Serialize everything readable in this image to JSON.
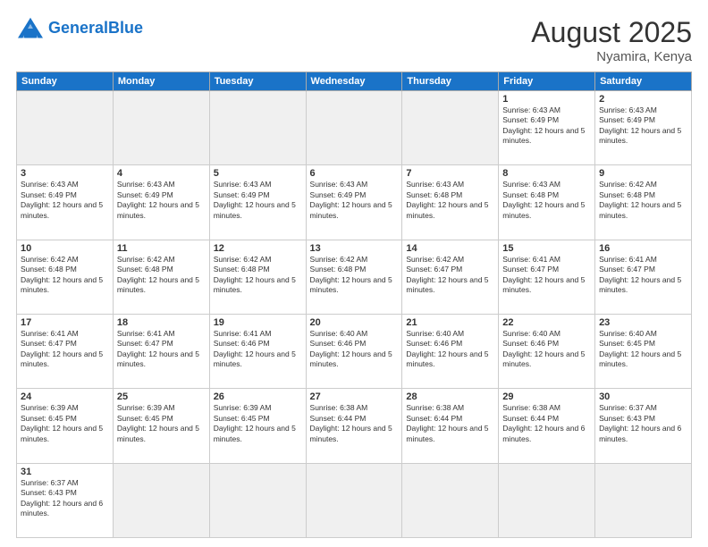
{
  "header": {
    "logo_general": "General",
    "logo_blue": "Blue",
    "month_title": "August 2025",
    "location": "Nyamira, Kenya"
  },
  "days_of_week": [
    "Sunday",
    "Monday",
    "Tuesday",
    "Wednesday",
    "Thursday",
    "Friday",
    "Saturday"
  ],
  "weeks": [
    [
      {
        "day": "",
        "info": "",
        "empty": true
      },
      {
        "day": "",
        "info": "",
        "empty": true
      },
      {
        "day": "",
        "info": "",
        "empty": true
      },
      {
        "day": "",
        "info": "",
        "empty": true
      },
      {
        "day": "",
        "info": "",
        "empty": true
      },
      {
        "day": "1",
        "info": "Sunrise: 6:43 AM\nSunset: 6:49 PM\nDaylight: 12 hours and 5 minutes."
      },
      {
        "day": "2",
        "info": "Sunrise: 6:43 AM\nSunset: 6:49 PM\nDaylight: 12 hours and 5 minutes."
      }
    ],
    [
      {
        "day": "3",
        "info": "Sunrise: 6:43 AM\nSunset: 6:49 PM\nDaylight: 12 hours and 5 minutes."
      },
      {
        "day": "4",
        "info": "Sunrise: 6:43 AM\nSunset: 6:49 PM\nDaylight: 12 hours and 5 minutes."
      },
      {
        "day": "5",
        "info": "Sunrise: 6:43 AM\nSunset: 6:49 PM\nDaylight: 12 hours and 5 minutes."
      },
      {
        "day": "6",
        "info": "Sunrise: 6:43 AM\nSunset: 6:49 PM\nDaylight: 12 hours and 5 minutes."
      },
      {
        "day": "7",
        "info": "Sunrise: 6:43 AM\nSunset: 6:48 PM\nDaylight: 12 hours and 5 minutes."
      },
      {
        "day": "8",
        "info": "Sunrise: 6:43 AM\nSunset: 6:48 PM\nDaylight: 12 hours and 5 minutes."
      },
      {
        "day": "9",
        "info": "Sunrise: 6:42 AM\nSunset: 6:48 PM\nDaylight: 12 hours and 5 minutes."
      }
    ],
    [
      {
        "day": "10",
        "info": "Sunrise: 6:42 AM\nSunset: 6:48 PM\nDaylight: 12 hours and 5 minutes."
      },
      {
        "day": "11",
        "info": "Sunrise: 6:42 AM\nSunset: 6:48 PM\nDaylight: 12 hours and 5 minutes."
      },
      {
        "day": "12",
        "info": "Sunrise: 6:42 AM\nSunset: 6:48 PM\nDaylight: 12 hours and 5 minutes."
      },
      {
        "day": "13",
        "info": "Sunrise: 6:42 AM\nSunset: 6:48 PM\nDaylight: 12 hours and 5 minutes."
      },
      {
        "day": "14",
        "info": "Sunrise: 6:42 AM\nSunset: 6:47 PM\nDaylight: 12 hours and 5 minutes."
      },
      {
        "day": "15",
        "info": "Sunrise: 6:41 AM\nSunset: 6:47 PM\nDaylight: 12 hours and 5 minutes."
      },
      {
        "day": "16",
        "info": "Sunrise: 6:41 AM\nSunset: 6:47 PM\nDaylight: 12 hours and 5 minutes."
      }
    ],
    [
      {
        "day": "17",
        "info": "Sunrise: 6:41 AM\nSunset: 6:47 PM\nDaylight: 12 hours and 5 minutes."
      },
      {
        "day": "18",
        "info": "Sunrise: 6:41 AM\nSunset: 6:47 PM\nDaylight: 12 hours and 5 minutes."
      },
      {
        "day": "19",
        "info": "Sunrise: 6:41 AM\nSunset: 6:46 PM\nDaylight: 12 hours and 5 minutes."
      },
      {
        "day": "20",
        "info": "Sunrise: 6:40 AM\nSunset: 6:46 PM\nDaylight: 12 hours and 5 minutes."
      },
      {
        "day": "21",
        "info": "Sunrise: 6:40 AM\nSunset: 6:46 PM\nDaylight: 12 hours and 5 minutes."
      },
      {
        "day": "22",
        "info": "Sunrise: 6:40 AM\nSunset: 6:46 PM\nDaylight: 12 hours and 5 minutes."
      },
      {
        "day": "23",
        "info": "Sunrise: 6:40 AM\nSunset: 6:45 PM\nDaylight: 12 hours and 5 minutes."
      }
    ],
    [
      {
        "day": "24",
        "info": "Sunrise: 6:39 AM\nSunset: 6:45 PM\nDaylight: 12 hours and 5 minutes."
      },
      {
        "day": "25",
        "info": "Sunrise: 6:39 AM\nSunset: 6:45 PM\nDaylight: 12 hours and 5 minutes."
      },
      {
        "day": "26",
        "info": "Sunrise: 6:39 AM\nSunset: 6:45 PM\nDaylight: 12 hours and 5 minutes."
      },
      {
        "day": "27",
        "info": "Sunrise: 6:38 AM\nSunset: 6:44 PM\nDaylight: 12 hours and 5 minutes."
      },
      {
        "day": "28",
        "info": "Sunrise: 6:38 AM\nSunset: 6:44 PM\nDaylight: 12 hours and 5 minutes."
      },
      {
        "day": "29",
        "info": "Sunrise: 6:38 AM\nSunset: 6:44 PM\nDaylight: 12 hours and 6 minutes."
      },
      {
        "day": "30",
        "info": "Sunrise: 6:37 AM\nSunset: 6:43 PM\nDaylight: 12 hours and 6 minutes."
      }
    ],
    [
      {
        "day": "31",
        "info": "Sunrise: 6:37 AM\nSunset: 6:43 PM\nDaylight: 12 hours and 6 minutes."
      },
      {
        "day": "",
        "info": "",
        "empty": true
      },
      {
        "day": "",
        "info": "",
        "empty": true
      },
      {
        "day": "",
        "info": "",
        "empty": true
      },
      {
        "day": "",
        "info": "",
        "empty": true
      },
      {
        "day": "",
        "info": "",
        "empty": true
      },
      {
        "day": "",
        "info": "",
        "empty": true
      }
    ]
  ]
}
